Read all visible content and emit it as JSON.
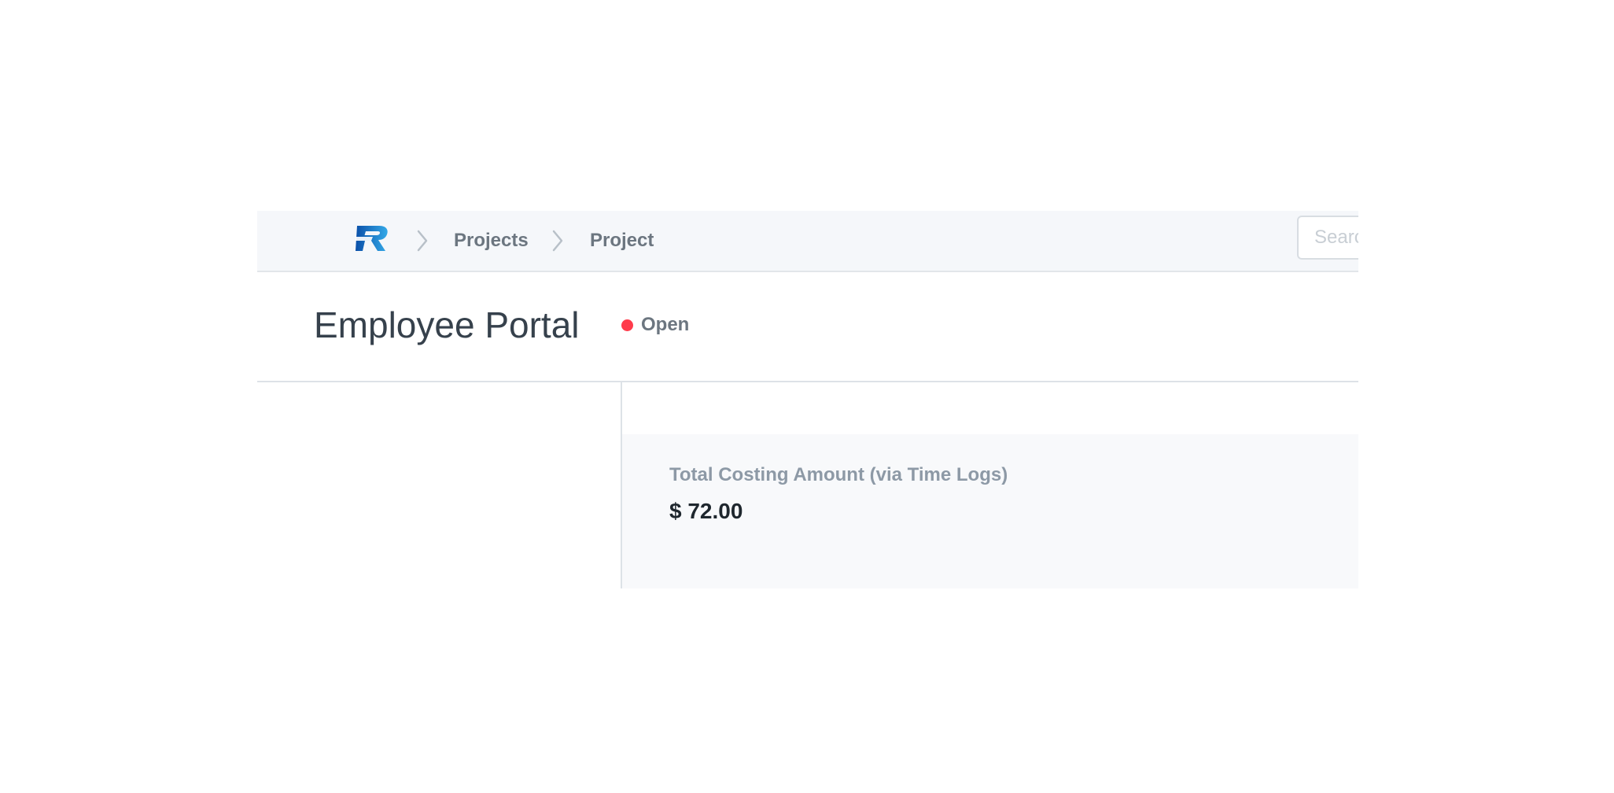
{
  "navbar": {
    "logo_icon": "r-logo-icon",
    "separator_icon": "chevron-right-icon",
    "breadcrumbs": [
      {
        "label": "Projects"
      },
      {
        "label": "Project"
      }
    ],
    "search": {
      "placeholder": "Search",
      "value": ""
    }
  },
  "page": {
    "title": "Employee Portal",
    "status": {
      "label": "Open",
      "color": "#ff3b4b"
    }
  },
  "stats": {
    "costing": {
      "label": "Total Costing Amount (via Time Logs)",
      "value": "$ 72.00"
    }
  },
  "colors": {
    "logo_dark": "#0a4fa8",
    "logo_light": "#33a9e8"
  }
}
